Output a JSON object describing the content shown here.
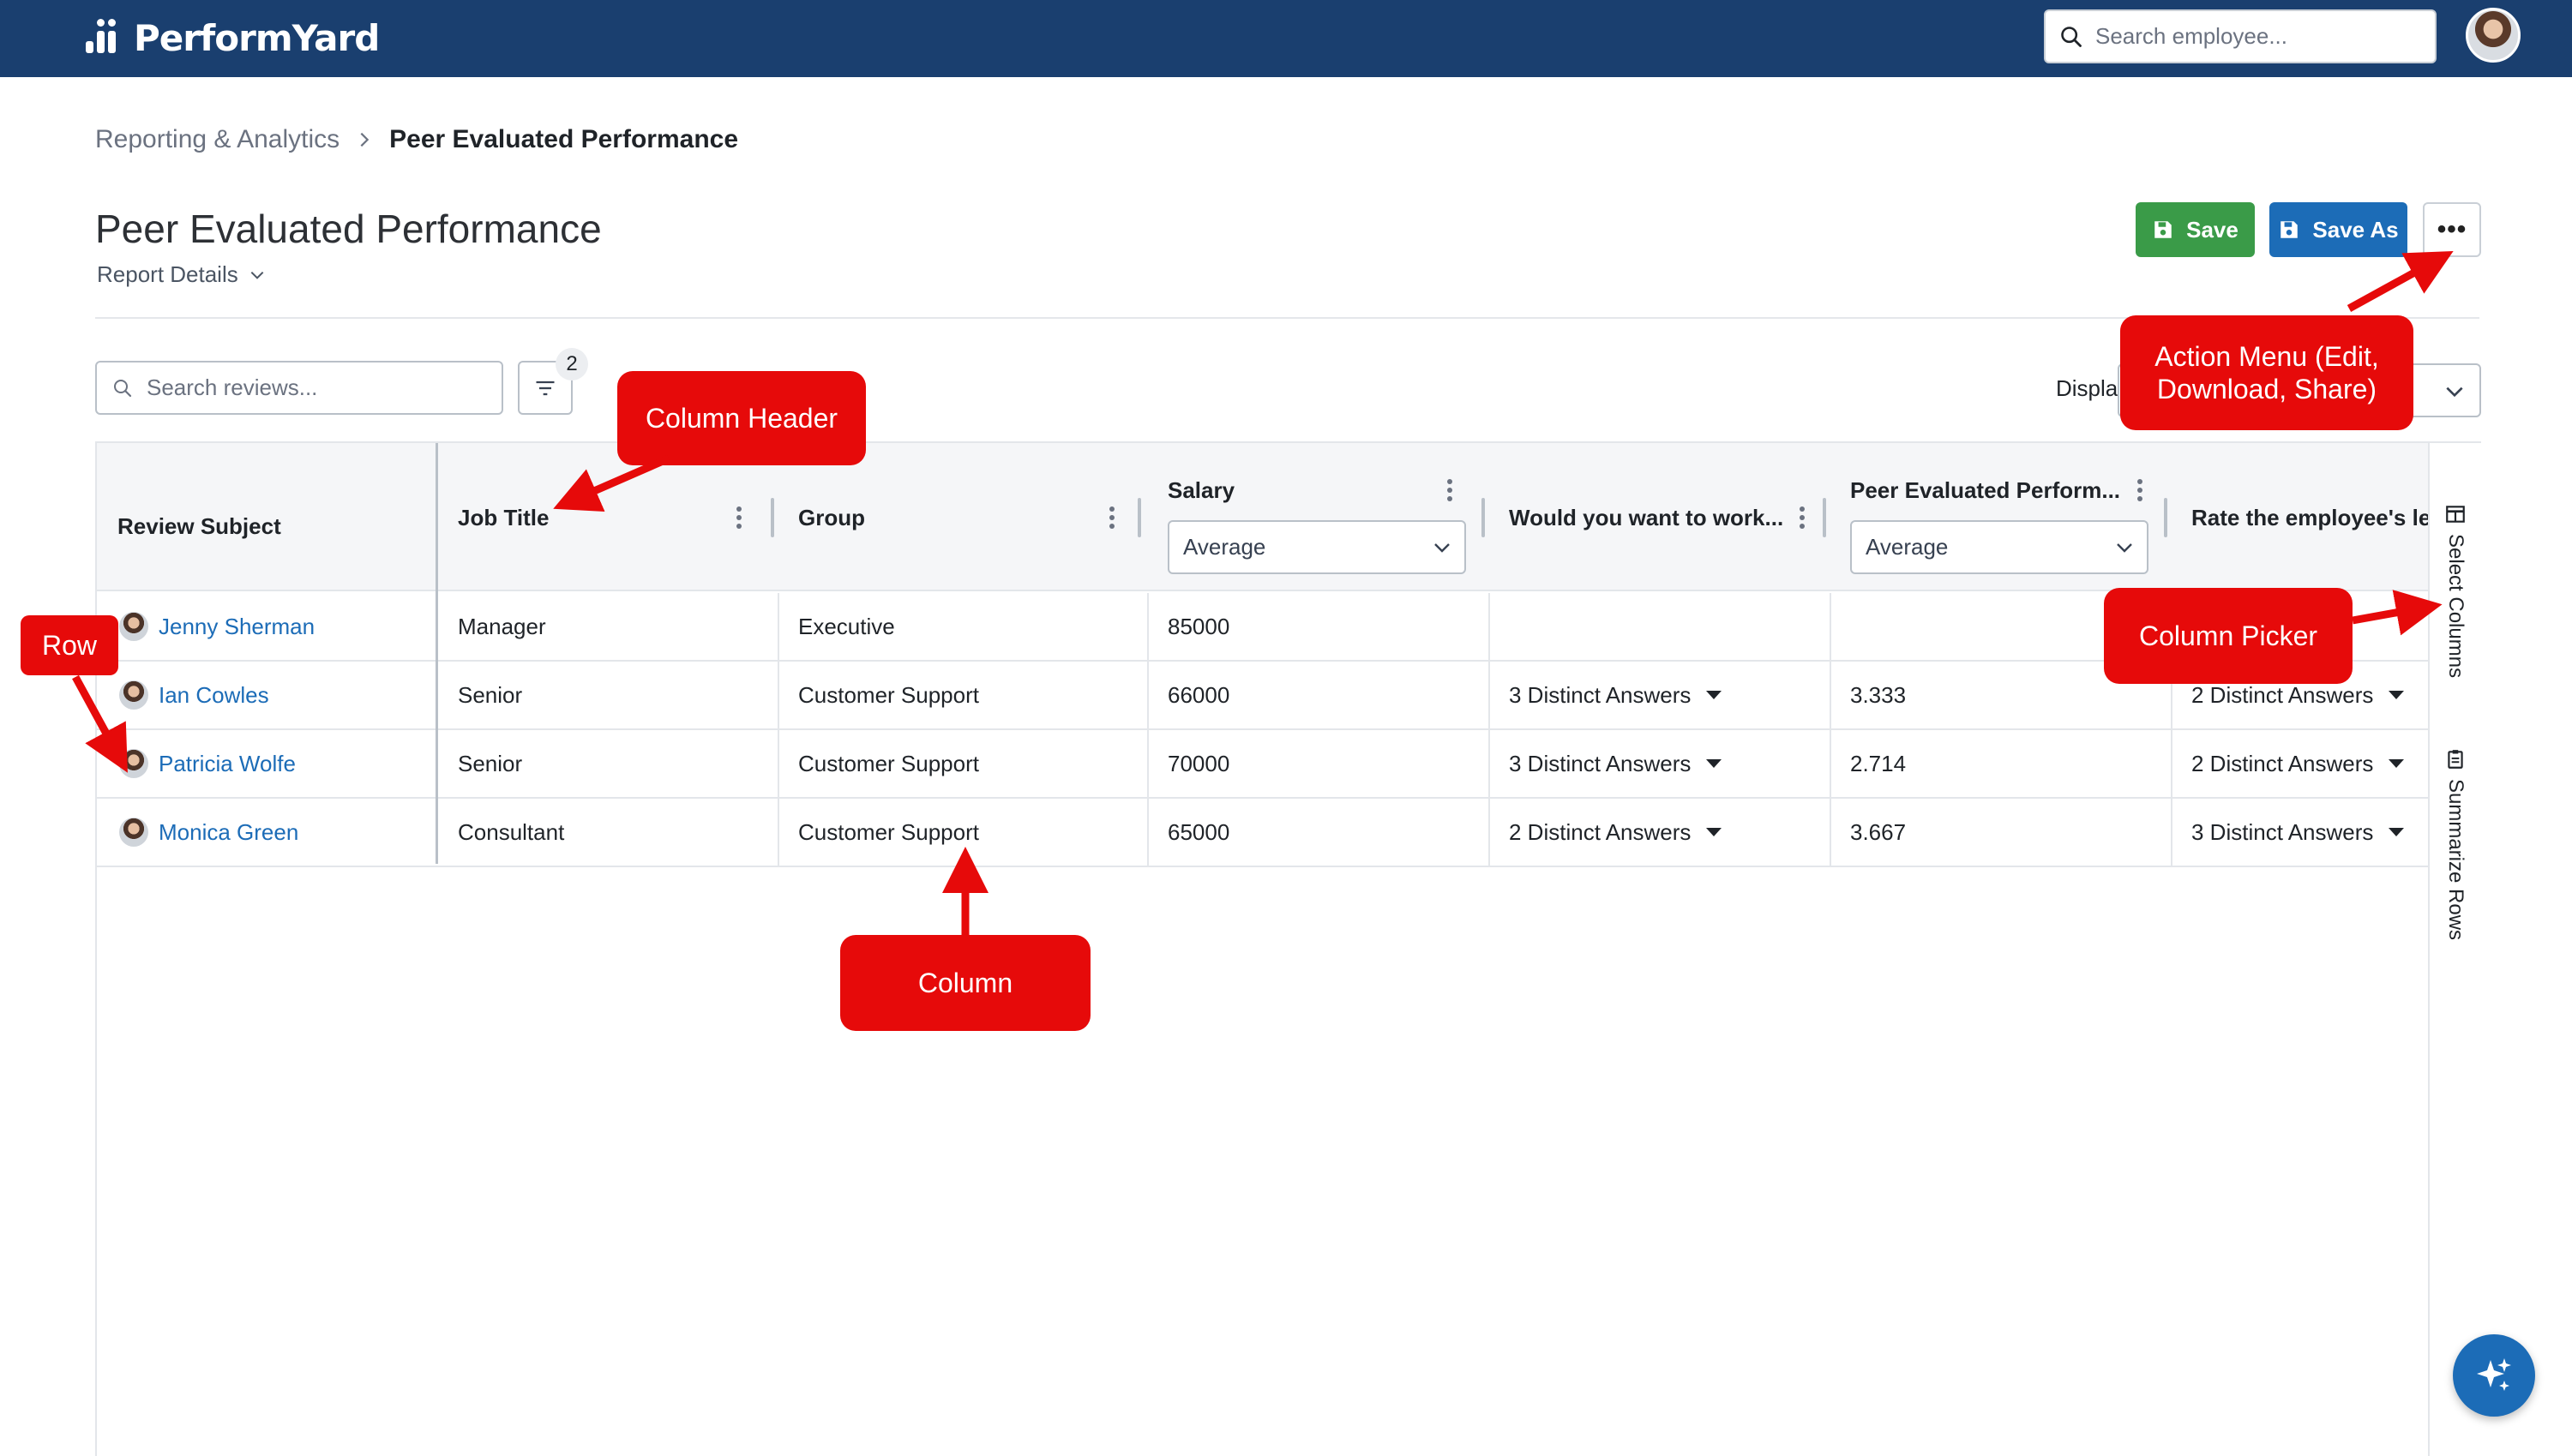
{
  "app": {
    "brand": "PerformYard",
    "search_placeholder": "Search employee..."
  },
  "breadcrumb": {
    "parent": "Reporting & Analytics",
    "current": "Peer Evaluated Performance"
  },
  "page": {
    "title": "Peer Evaluated Performance",
    "details_label": "Report Details"
  },
  "toolbar": {
    "save_label": "Save",
    "save_as_label": "Save As",
    "more_label": "•••",
    "search_placeholder": "Search reviews...",
    "filter_count": "2",
    "display_label": "Displa"
  },
  "table": {
    "columns": [
      {
        "label": "Review Subject"
      },
      {
        "label": "Job Title"
      },
      {
        "label": "Group"
      },
      {
        "label": "Salary",
        "aggregate": "Average"
      },
      {
        "label": "Would you want to work..."
      },
      {
        "label": "Peer Evaluated Perform...",
        "aggregate": "Average"
      },
      {
        "label": "Rate the employee's le"
      }
    ],
    "rows": [
      {
        "subject": "Jenny Sherman",
        "job_title": "Manager",
        "group": "Executive",
        "salary": "85000",
        "work_with": "",
        "peer_perf": "",
        "rate": ""
      },
      {
        "subject": "Ian Cowles",
        "job_title": "Senior",
        "group": "Customer Support",
        "salary": "66000",
        "work_with": "3 Distinct Answers",
        "peer_perf": "3.333",
        "rate": "2 Distinct Answers"
      },
      {
        "subject": "Patricia Wolfe",
        "job_title": "Senior",
        "group": "Customer Support",
        "salary": "70000",
        "work_with": "3 Distinct Answers",
        "peer_perf": "2.714",
        "rate": "2 Distinct Answers"
      },
      {
        "subject": "Monica Green",
        "job_title": "Consultant",
        "group": "Customer Support",
        "salary": "65000",
        "work_with": "2 Distinct Answers",
        "peer_perf": "3.667",
        "rate": "3 Distinct Answers"
      }
    ]
  },
  "side_panel": {
    "select_columns": "Select Columns",
    "summarize_rows": "Summarize Rows"
  },
  "annotations": {
    "column_header": "Column Header",
    "action_menu": "Action Menu (Edit, Download, Share)",
    "row": "Row",
    "column_picker": "Column Picker",
    "column": "Column"
  },
  "colors": {
    "topbar": "#1a3f6f",
    "save": "#3a9b48",
    "save_as": "#1c6cb7",
    "link": "#1c6cb7",
    "callout": "#e60a0a"
  },
  "icons": [
    "search-icon",
    "chevron-right-icon",
    "chevron-down-icon",
    "save-icon",
    "filter-icon",
    "kebab-icon",
    "table-icon",
    "clipboard-icon",
    "sparkle-icon"
  ]
}
